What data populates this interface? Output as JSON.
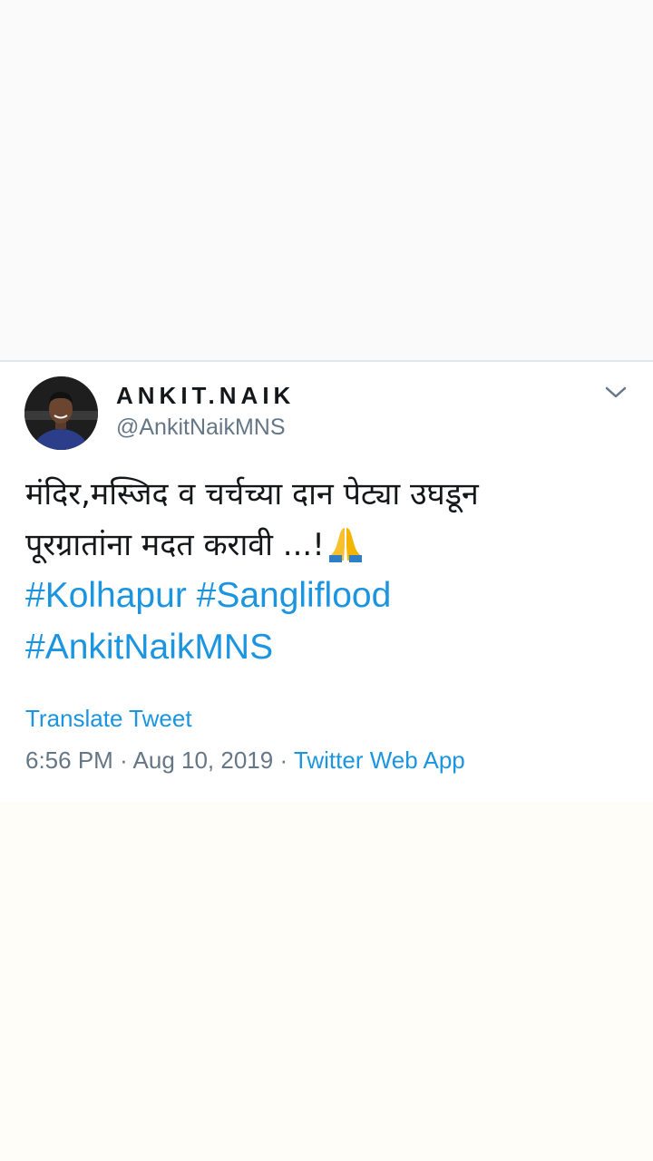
{
  "tweet": {
    "display_name": "ANKIT.NAIK",
    "handle": "@AnkitNaikMNS",
    "text_line1": "मंदिर,मस्जिद व चर्चच्या दान पेट्या उघडून",
    "text_line2": "पूरग्रातांना मदत करावी ...!",
    "emoji": "folded-hands-emoji",
    "hashtags": [
      "#Kolhapur",
      "#Sangliflood",
      "#AnkitNaikMNS"
    ],
    "translate_label": "Translate Tweet",
    "time": "6:56 PM",
    "date": "Aug 10, 2019",
    "separator": "·",
    "source": "Twitter Web App"
  },
  "icons": {
    "menu": "chevron-down-icon",
    "avatar": "avatar"
  },
  "colors": {
    "link": "#1b95e0",
    "secondary_text": "#657786",
    "primary_text": "#14171a",
    "divider": "#e6ecf0"
  }
}
